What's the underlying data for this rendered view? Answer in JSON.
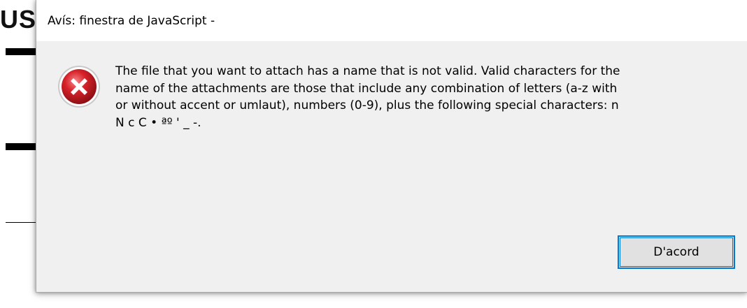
{
  "background": {
    "heading_fragment": "US"
  },
  "dialog": {
    "title": "Avís: finestra de JavaScript -",
    "icon": "error-icon",
    "message_lines": [
      "The file that you want to attach has a name that is not valid. Valid characters for the",
      "name of the attachments are those that include any combination of letters (a-z with",
      "or without accent or umlaut), numbers (0-9), plus the following special characters: n",
      "N c C • ªº ' _ -."
    ],
    "ok_button_label": "D'acord"
  },
  "colors": {
    "dialog_body": "#f0f0f0",
    "titlebar": "#ffffff",
    "accent_focus": "#0078d7",
    "error_red": "#c42b1c"
  }
}
